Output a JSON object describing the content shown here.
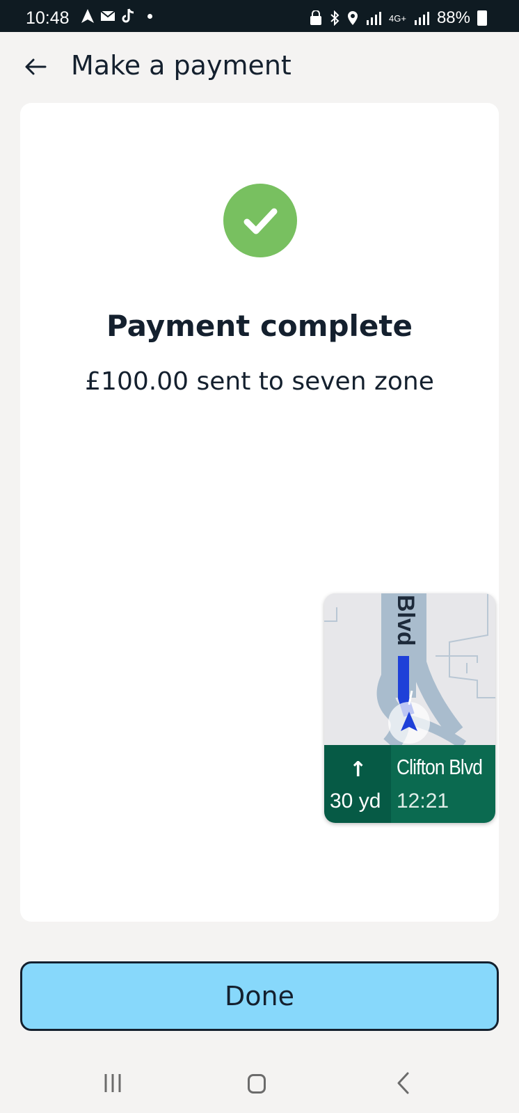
{
  "status_bar": {
    "time": "10:48",
    "battery": "88%",
    "left_icons": [
      "navigation-icon",
      "mail-icon",
      "tiktok-icon",
      "notification-dot"
    ],
    "right_icons": [
      "vpn-lock-icon",
      "bluetooth-icon",
      "location-icon",
      "roaming-signal-icon",
      "4g-icon",
      "signal-icon",
      "battery-charging-icon"
    ],
    "network_label": "4G+"
  },
  "header": {
    "title": "Make a payment",
    "back_icon": "arrow-left-icon"
  },
  "payment": {
    "status_icon": "check-circle-icon",
    "status_color": "#78c060",
    "title": "Payment complete",
    "subtitle": "£100.00 sent to seven zone"
  },
  "navigation_overlay": {
    "map_road_label": "Blvd",
    "turn_icon": "arrow-up-icon",
    "distance": "30 yd",
    "street": "Clifton Blvd",
    "eta": "12:21",
    "colors": {
      "panel_dark": "#065a45",
      "panel": "#0b6a50",
      "route": "#1e40d8"
    }
  },
  "footer": {
    "done_label": "Done",
    "button_color": "#87d8fb"
  },
  "system_nav": {
    "icons": [
      "recents-icon",
      "home-icon",
      "back-icon"
    ]
  }
}
